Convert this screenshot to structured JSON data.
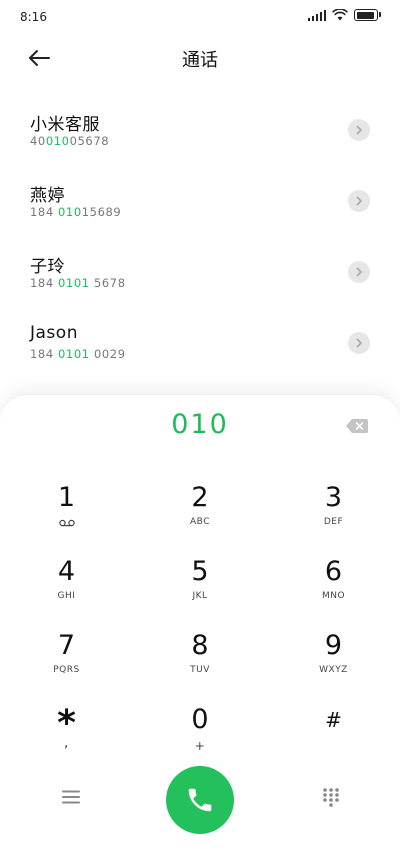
{
  "status_bar": {
    "time": "8:16"
  },
  "header": {
    "title": "通话"
  },
  "contacts": [
    {
      "name": "小米客服",
      "number_parts": [
        "40",
        "010",
        "05678"
      ]
    },
    {
      "name": "燕婷",
      "number_parts": [
        "184 ",
        "010",
        "15689"
      ]
    },
    {
      "name": "子玲",
      "number_parts": [
        "184 ",
        "0101",
        " 5678"
      ]
    },
    {
      "name": "Jason",
      "number_parts": [
        "184 ",
        "0101",
        " 0029"
      ]
    }
  ],
  "dialpad": {
    "typed_number": "010",
    "keys": [
      {
        "digit": "1",
        "letters": ""
      },
      {
        "digit": "2",
        "letters": "ABC"
      },
      {
        "digit": "3",
        "letters": "DEF"
      },
      {
        "digit": "4",
        "letters": "GHI"
      },
      {
        "digit": "5",
        "letters": "JKL"
      },
      {
        "digit": "6",
        "letters": "MNO"
      },
      {
        "digit": "7",
        "letters": "PQRS"
      },
      {
        "digit": "8",
        "letters": "TUV"
      },
      {
        "digit": "9",
        "letters": "WXYZ"
      },
      {
        "digit": "*",
        "letters": ","
      },
      {
        "digit": "0",
        "letters": "+"
      },
      {
        "digit": "#",
        "letters": ""
      }
    ]
  },
  "icons": {
    "back": "arrow-left-icon",
    "contact_detail": "chevron-right-icon",
    "backspace": "backspace-icon",
    "voicemail": "voicemail-icon",
    "menu": "menu-icon",
    "call": "phone-icon",
    "keypad": "dialpad-icon"
  },
  "colors": {
    "accent": "#1fba5a",
    "call_button": "#23c05c"
  }
}
